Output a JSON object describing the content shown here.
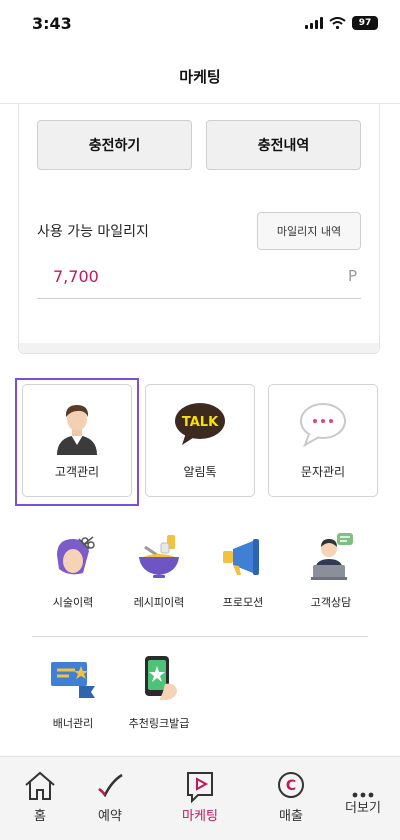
{
  "status": {
    "time": "3:43",
    "battery": "97"
  },
  "header": {
    "title": "마케팅"
  },
  "charge": {
    "charge_label": "충전하기",
    "history_label": "충전내역"
  },
  "mileage": {
    "label": "사용 가능 마일리지",
    "history_button": "마일리지 내역",
    "value": "7,700",
    "unit": "P"
  },
  "tiles": [
    {
      "label": "고객관리",
      "icon": "customer-avatar-icon",
      "selected": true
    },
    {
      "label": "알림톡",
      "icon": "kakao-talk-icon"
    },
    {
      "label": "문자관리",
      "icon": "message-bubble-icon"
    }
  ],
  "menu": [
    {
      "label": "시술이력",
      "icon": "hair-scissors-icon"
    },
    {
      "label": "레시피이력",
      "icon": "recipe-bowl-icon"
    },
    {
      "label": "프로모션",
      "icon": "megaphone-icon"
    },
    {
      "label": "고객상담",
      "icon": "consultant-icon"
    },
    {
      "label": "배너관리",
      "icon": "banner-icon"
    },
    {
      "label": "추천링크발급",
      "icon": "phone-star-icon"
    }
  ],
  "tabs": [
    {
      "label": "홈",
      "icon": "home-icon"
    },
    {
      "label": "예약",
      "icon": "check-icon"
    },
    {
      "label": "마케팅",
      "icon": "marketing-icon",
      "active": true
    },
    {
      "label": "매출",
      "icon": "sales-c-icon"
    },
    {
      "label": "더보기",
      "icon": "more-icon"
    }
  ],
  "colors": {
    "accent": "#c2185b",
    "selection": "#7b4fd6",
    "tab_bg": "#f4f4f4"
  }
}
